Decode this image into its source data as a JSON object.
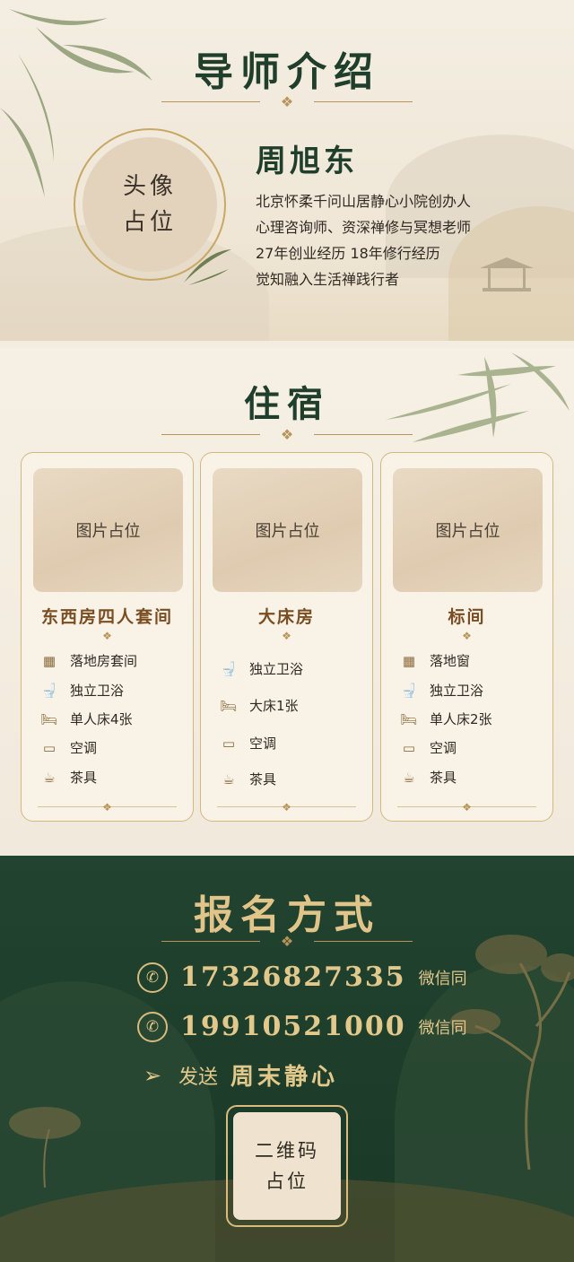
{
  "mentor": {
    "title": "导师介绍",
    "avatar_line1": "头像",
    "avatar_line2": "占位",
    "name": "周旭东",
    "lines": [
      "北京怀柔千问山居静心小院创办人",
      "心理咨询师、资深禅修与冥想老师",
      "27年创业经历 18年修行经历",
      "觉知融入生活禅践行者"
    ]
  },
  "lodging": {
    "title": "住宿",
    "rooms": [
      {
        "photo": "图片占位",
        "name": "东西房四人套间",
        "features": [
          {
            "icon": "window-icon",
            "label": "落地房套间"
          },
          {
            "icon": "toilet-icon",
            "label": "独立卫浴"
          },
          {
            "icon": "bed-icon",
            "label": "单人床4张"
          },
          {
            "icon": "air-conditioner-icon",
            "label": "空调"
          },
          {
            "icon": "teapot-icon",
            "label": "茶具"
          }
        ]
      },
      {
        "photo": "图片占位",
        "name": "大床房",
        "features": [
          {
            "icon": "toilet-icon",
            "label": "独立卫浴"
          },
          {
            "icon": "bed-icon",
            "label": "大床1张"
          },
          {
            "icon": "air-conditioner-icon",
            "label": "空调"
          },
          {
            "icon": "teapot-icon",
            "label": "茶具"
          }
        ]
      },
      {
        "photo": "图片占位",
        "name": "标间",
        "features": [
          {
            "icon": "window-icon",
            "label": "落地窗"
          },
          {
            "icon": "toilet-icon",
            "label": "独立卫浴"
          },
          {
            "icon": "bed-icon",
            "label": "单人床2张"
          },
          {
            "icon": "air-conditioner-icon",
            "label": "空调"
          },
          {
            "icon": "teapot-icon",
            "label": "茶具"
          }
        ]
      }
    ]
  },
  "signup": {
    "title": "报名方式",
    "phones": [
      {
        "number": "17326827335",
        "note": "微信同"
      },
      {
        "number": "19910521000",
        "note": "微信同"
      }
    ],
    "send_label": "发送",
    "send_keyword": "周末静心",
    "qr_line1": "二维码",
    "qr_line2": "占位"
  },
  "colors": {
    "dark_green": "#1f3f2c",
    "gold": "#d8bb7d",
    "brown_title": "#7a4e22",
    "cream": "#f3ece0"
  }
}
